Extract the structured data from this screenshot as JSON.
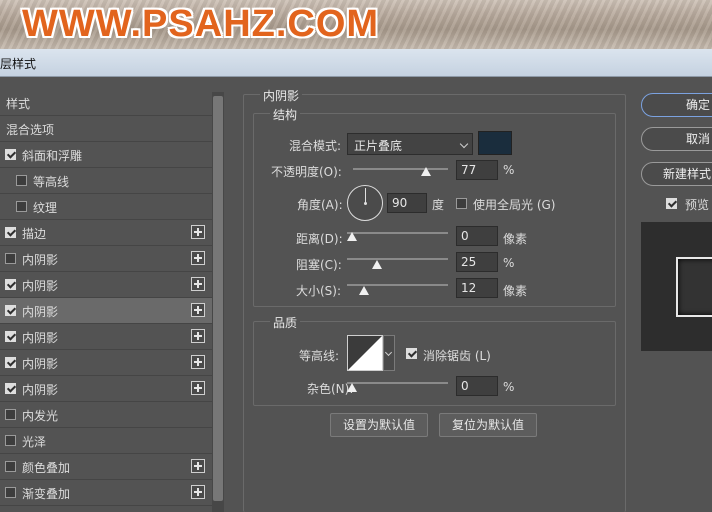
{
  "banner": {
    "text": "WWW.PSAHZ.COM"
  },
  "window": {
    "title": "层样式"
  },
  "style_list": [
    {
      "label": "样式",
      "checkbox": false,
      "checked": false,
      "plus": false,
      "indent": 0
    },
    {
      "label": "混合选项",
      "checkbox": false,
      "checked": false,
      "plus": false,
      "indent": 0
    },
    {
      "label": "斜面和浮雕",
      "checkbox": true,
      "checked": true,
      "plus": false,
      "indent": 0
    },
    {
      "label": "等高线",
      "checkbox": true,
      "checked": false,
      "plus": false,
      "indent": 1
    },
    {
      "label": "纹理",
      "checkbox": true,
      "checked": false,
      "plus": false,
      "indent": 1
    },
    {
      "label": "描边",
      "checkbox": true,
      "checked": true,
      "plus": true,
      "indent": 0
    },
    {
      "label": "内阴影",
      "checkbox": true,
      "checked": false,
      "plus": true,
      "indent": 0
    },
    {
      "label": "内阴影",
      "checkbox": true,
      "checked": true,
      "plus": true,
      "indent": 0
    },
    {
      "label": "内阴影",
      "checkbox": true,
      "checked": true,
      "plus": true,
      "indent": 0,
      "selected": true
    },
    {
      "label": "内阴影",
      "checkbox": true,
      "checked": true,
      "plus": true,
      "indent": 0
    },
    {
      "label": "内阴影",
      "checkbox": true,
      "checked": true,
      "plus": true,
      "indent": 0
    },
    {
      "label": "内阴影",
      "checkbox": true,
      "checked": true,
      "plus": true,
      "indent": 0
    },
    {
      "label": "内发光",
      "checkbox": true,
      "checked": false,
      "plus": false,
      "indent": 0
    },
    {
      "label": "光泽",
      "checkbox": true,
      "checked": false,
      "plus": false,
      "indent": 0
    },
    {
      "label": "颜色叠加",
      "checkbox": true,
      "checked": false,
      "plus": true,
      "indent": 0
    },
    {
      "label": "渐变叠加",
      "checkbox": true,
      "checked": false,
      "plus": true,
      "indent": 0
    }
  ],
  "panel": {
    "title": "内阴影",
    "structure": {
      "title": "结构",
      "blend_mode_label": "混合模式:",
      "blend_mode_value": "正片叠底",
      "color": "#1a2d3d",
      "opacity_label": "不透明度(O):",
      "opacity_value": "77",
      "opacity_level": 0.77,
      "percent": "%",
      "angle_label": "角度(A):",
      "angle_value": "90",
      "angle_unit": "度",
      "global_light_label": "使用全局光 (G)",
      "global_light_checked": false,
      "distance_label": "距离(D):",
      "distance_value": "0",
      "distance_level": 0.0,
      "pixel_unit": "像素",
      "choke_label": "阻塞(C):",
      "choke_value": "25",
      "choke_level": 0.25,
      "size_label": "大小(S):",
      "size_value": "12",
      "size_level": 0.12
    },
    "quality": {
      "title": "品质",
      "contour_label": "等高线:",
      "antialias_label": "消除锯齿 (L)",
      "antialias_checked": true,
      "noise_label": "杂色(N):",
      "noise_value": "0",
      "noise_level": 0.0,
      "percent": "%"
    },
    "buttons": {
      "set_default": "设置为默认值",
      "reset_default": "复位为默认值"
    }
  },
  "right": {
    "ok": "确定",
    "cancel": "取消",
    "new_style": "新建样式...",
    "preview_label": "预览",
    "preview_checked": true
  }
}
